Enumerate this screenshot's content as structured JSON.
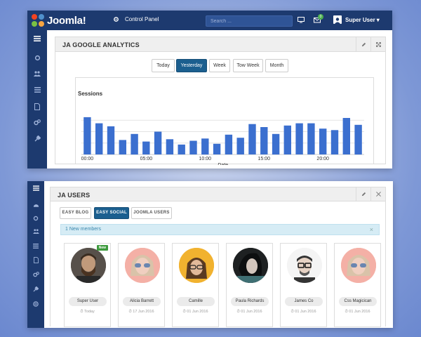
{
  "app": {
    "logo_text": "Joomla!",
    "breadcrumb": "Control Panel",
    "search_placeholder": "Search ...",
    "notification_count": "0",
    "user_name": "Super User",
    "user_menu_caret": "▾"
  },
  "analytics": {
    "title": "JA GOOGLE ANALYTICS",
    "periods": [
      "Today",
      "Yesterday",
      "Week",
      "Tow Week",
      "Month"
    ],
    "active_period": "Yesterday"
  },
  "chart_data": {
    "type": "bar",
    "title": "Sessions",
    "xlabel": "Date",
    "ylabel": "",
    "x_ticks": [
      "00:00",
      "05:00",
      "10:00",
      "15:00",
      "20:00"
    ],
    "grid": true,
    "categories": [
      "00:00",
      "01:00",
      "02:00",
      "03:00",
      "04:00",
      "05:00",
      "06:00",
      "07:00",
      "08:00",
      "09:00",
      "10:00",
      "11:00",
      "12:00",
      "13:00",
      "14:00",
      "15:00",
      "16:00",
      "17:00",
      "18:00",
      "19:00",
      "20:00",
      "21:00",
      "22:00",
      "23:00"
    ],
    "values": [
      49,
      41,
      37,
      19,
      27,
      17,
      30,
      20,
      13,
      18,
      21,
      14,
      26,
      22,
      40,
      36,
      27,
      38,
      41,
      41,
      34,
      32,
      48,
      39
    ],
    "ylim": [
      0,
      60
    ],
    "bar_color": "#3b6fcf"
  },
  "users": {
    "title": "JA USERS",
    "tabs": [
      "EASY BLOG",
      "EASY SOCIAL",
      "JOOMLA USERS"
    ],
    "active_tab": "EASY SOCIAL",
    "alert": "1 New members",
    "alert_close": "×",
    "new_label": "New",
    "members": [
      {
        "name": "Super User",
        "date": "Today",
        "is_new": true
      },
      {
        "name": "Alicia Barrett",
        "date": "17 Jun 2016",
        "is_new": false
      },
      {
        "name": "Camille",
        "date": "01 Jun 2016",
        "is_new": false
      },
      {
        "name": "Paula Richards",
        "date": "01 Jun 2016",
        "is_new": false
      },
      {
        "name": "James Co",
        "date": "01 Jun 2016",
        "is_new": false
      },
      {
        "name": "Css Magicican",
        "date": "01 Jun 2016",
        "is_new": false
      }
    ]
  },
  "colors": {
    "navy": "#1d3a6f",
    "active_button": "#1b5f8f",
    "alert_bg": "#d6ecf5",
    "new_badge": "#3c9a3c"
  }
}
